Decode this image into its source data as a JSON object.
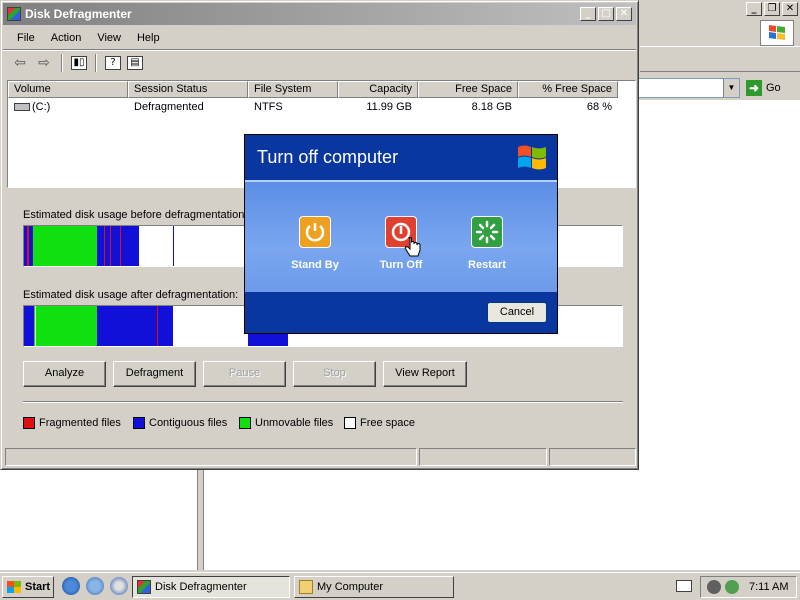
{
  "background_window": {
    "go_label": "Go",
    "left_pane_blank": "",
    "icons": [
      "windows-flag-icon",
      "address-dropdown-icon",
      "go-arrow-icon"
    ]
  },
  "defrag_window": {
    "title": "Disk Defragmenter",
    "menu": [
      "File",
      "Action",
      "View",
      "Help"
    ],
    "toolbar_icons": [
      "back-arrow-icon",
      "forward-arrow-icon",
      "show-hide-console-tree-icon",
      "help-icon",
      "properties-icon"
    ],
    "columns": [
      "Volume",
      "Session Status",
      "File System",
      "Capacity",
      "Free Space",
      "% Free Space"
    ],
    "volumes": [
      {
        "volume": "(C:)",
        "status": "Defragmented",
        "file_system": "NTFS",
        "capacity": "11.99 GB",
        "free_space": "8.18 GB",
        "pct_free": "68 %"
      }
    ],
    "before_label": "Estimated disk usage before defragmentation:",
    "after_label": "Estimated disk usage after defragmentation:",
    "buttons": {
      "analyze": "Analyze",
      "defragment": "Defragment",
      "pause": "Pause",
      "stop": "Stop",
      "view_report": "View Report"
    },
    "legend": [
      {
        "label": "Fragmented files",
        "color": "#e01010"
      },
      {
        "label": "Contiguous files",
        "color": "#1010d8"
      },
      {
        "label": "Unmovable files",
        "color": "#10e010"
      },
      {
        "label": "Free space",
        "color": "#ffffff"
      }
    ]
  },
  "turn_off_dialog": {
    "title": "Turn off computer",
    "options": [
      {
        "label": "Stand By",
        "color": "#f0a020"
      },
      {
        "label": "Turn Off",
        "color": "#e04030"
      },
      {
        "label": "Restart",
        "color": "#30a040"
      }
    ],
    "cancel_label": "Cancel"
  },
  "taskbar": {
    "start_label": "Start",
    "tasks": [
      "Disk Defragmenter",
      "My Computer"
    ],
    "clock": "7:11 AM"
  }
}
